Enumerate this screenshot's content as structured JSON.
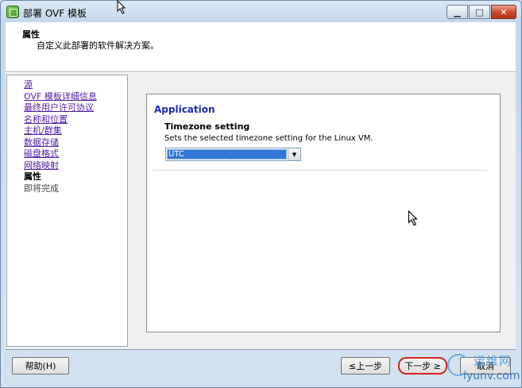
{
  "window": {
    "title": "部署 OVF 模板"
  },
  "header": {
    "title": "属性",
    "description": "自定义此部署的软件解决方案。"
  },
  "nav": {
    "items": [
      {
        "label": "源",
        "state": "link"
      },
      {
        "label": "OVF 模板详细信息",
        "state": "link"
      },
      {
        "label": "最终用户许可协议",
        "state": "link"
      },
      {
        "label": "名称和位置",
        "state": "link"
      },
      {
        "label": "主机/群集",
        "state": "link"
      },
      {
        "label": "数据存储",
        "state": "link"
      },
      {
        "label": "磁盘格式",
        "state": "link"
      },
      {
        "label": "网络映射",
        "state": "link"
      },
      {
        "label": "属性",
        "state": "current"
      },
      {
        "label": "即将完成",
        "state": "pending"
      }
    ]
  },
  "content": {
    "section_title": "Application",
    "field_title": "Timezone setting",
    "field_description": "Sets the selected timezone setting for the Linux VM.",
    "timezone_value": "UTC"
  },
  "footer": {
    "help_label": "帮助(H)",
    "back_label": "≤上一步",
    "next_label": "下一步 ≥",
    "cancel_label": "取消"
  },
  "watermark": {
    "top": "运维网",
    "bottom": "iyunv.com"
  },
  "colors": {
    "section_title": "#1d2ab5",
    "link": "#5319a8",
    "highlight": "#d62020",
    "selection": "#3178d8"
  }
}
